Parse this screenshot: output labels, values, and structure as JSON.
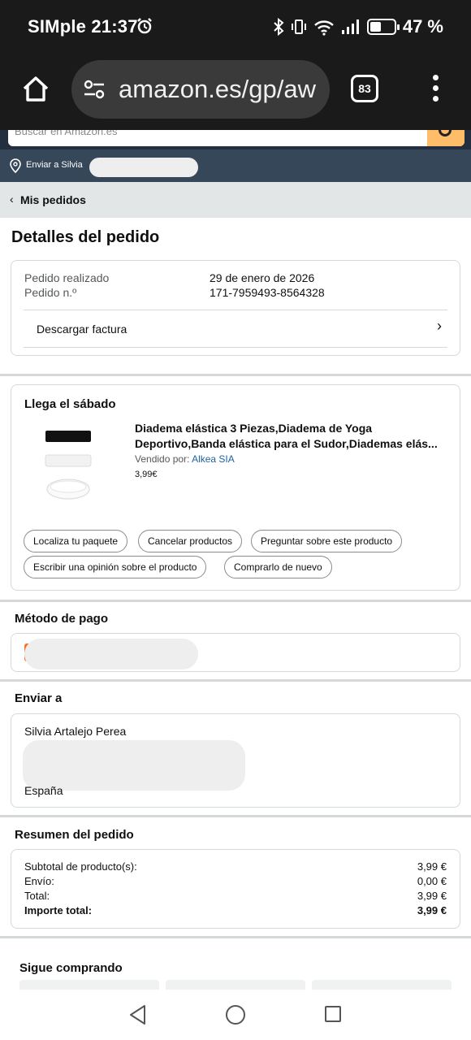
{
  "status_bar": {
    "carrier_time": "SIMple 21:37",
    "battery": "47 %",
    "battery_level": 0.47
  },
  "browser": {
    "url": "amazon.es/gp/aw",
    "tab_count": "83"
  },
  "amazon_header": {
    "search_placeholder": "Buscar en Amazon.es",
    "deliver_to": "Enviar a Silvia"
  },
  "breadcrumb": {
    "back_label": "Mis pedidos"
  },
  "page_title": "Detalles del pedido",
  "order_info": {
    "placed_label": "Pedido realizado",
    "placed_value": "29 de enero de 2026",
    "number_label": "Pedido n.º",
    "number_value": "171-7959493-8564328",
    "invoice_label": "Descargar factura"
  },
  "shipment": {
    "title": "Llega el sábado",
    "product_title": "Diadema elástica 3 Piezas,Diadema de Yoga Deportivo,Banda elástica para el Sudor,Diademas elás...",
    "seller_prefix": "Vendido por:",
    "seller_name": "Alkea SIA",
    "price": "3,99€",
    "actions": [
      "Localiza tu paquete",
      "Cancelar productos",
      "Preguntar sobre este producto",
      "Escribir una opinión sobre el producto",
      "Comprarlo de nuevo"
    ]
  },
  "payment": {
    "title": "Método de pago"
  },
  "shipping": {
    "title": "Enviar a",
    "name": "Silvia Artalejo Perea",
    "country": "España"
  },
  "summary": {
    "title": "Resumen del pedido",
    "rows": [
      {
        "label": "Subtotal de producto(s):",
        "value": "3,99 €"
      },
      {
        "label": "Envío:",
        "value": "0,00 €"
      },
      {
        "label": "Total:",
        "value": "3,99 €"
      },
      {
        "label": "Importe total:",
        "value": "3,99 €"
      }
    ]
  },
  "keep_shopping": {
    "title": "Sigue comprando"
  },
  "colors": {
    "amazon_navy": "#232f3e",
    "deliver_bar": "#37475a",
    "search_button": "#febd69",
    "link": "#2162a1",
    "card_logo": "#ff6a1f"
  }
}
